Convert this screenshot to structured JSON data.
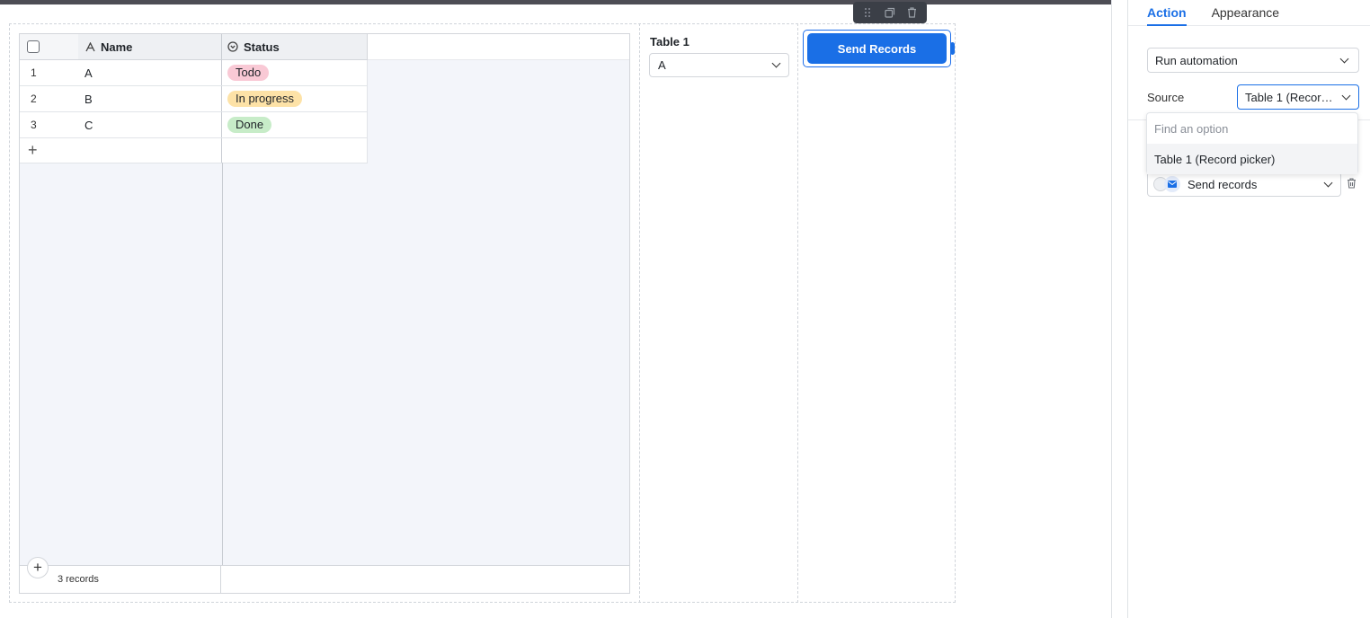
{
  "grid": {
    "columns": {
      "name": "Name",
      "status": "Status"
    },
    "rows": [
      {
        "num": "1",
        "name": "A",
        "status": "Todo"
      },
      {
        "num": "2",
        "name": "B",
        "status": "In progress"
      },
      {
        "num": "3",
        "name": "C",
        "status": "Done"
      }
    ],
    "add_row_symbol": "+",
    "footer_add_symbol": "+",
    "record_count": "3 records"
  },
  "status_colors": {
    "Todo": {
      "bg": "#f9c9d5",
      "fg": "#1f2328"
    },
    "In progress": {
      "bg": "#fde2a7",
      "fg": "#1f2328"
    },
    "Done": {
      "bg": "#c7ecc8",
      "fg": "#1f2328"
    }
  },
  "record_picker": {
    "label": "Table 1",
    "value": "A"
  },
  "button": {
    "label": "Send Records",
    "color": "#1a6fe6"
  },
  "element_toolbar": {
    "icons": [
      "drag-handle-icon",
      "duplicate-icon",
      "trash-icon"
    ]
  },
  "panel": {
    "tabs": {
      "action": "Action",
      "appearance": "Appearance"
    },
    "action_type": "Run automation",
    "source_label": "Source",
    "source_value": "Table 1 (Record ...",
    "dropdown": {
      "search_placeholder": "Find an option",
      "options": [
        "Table 1 (Record picker)"
      ]
    },
    "automation_action": "Send records"
  }
}
